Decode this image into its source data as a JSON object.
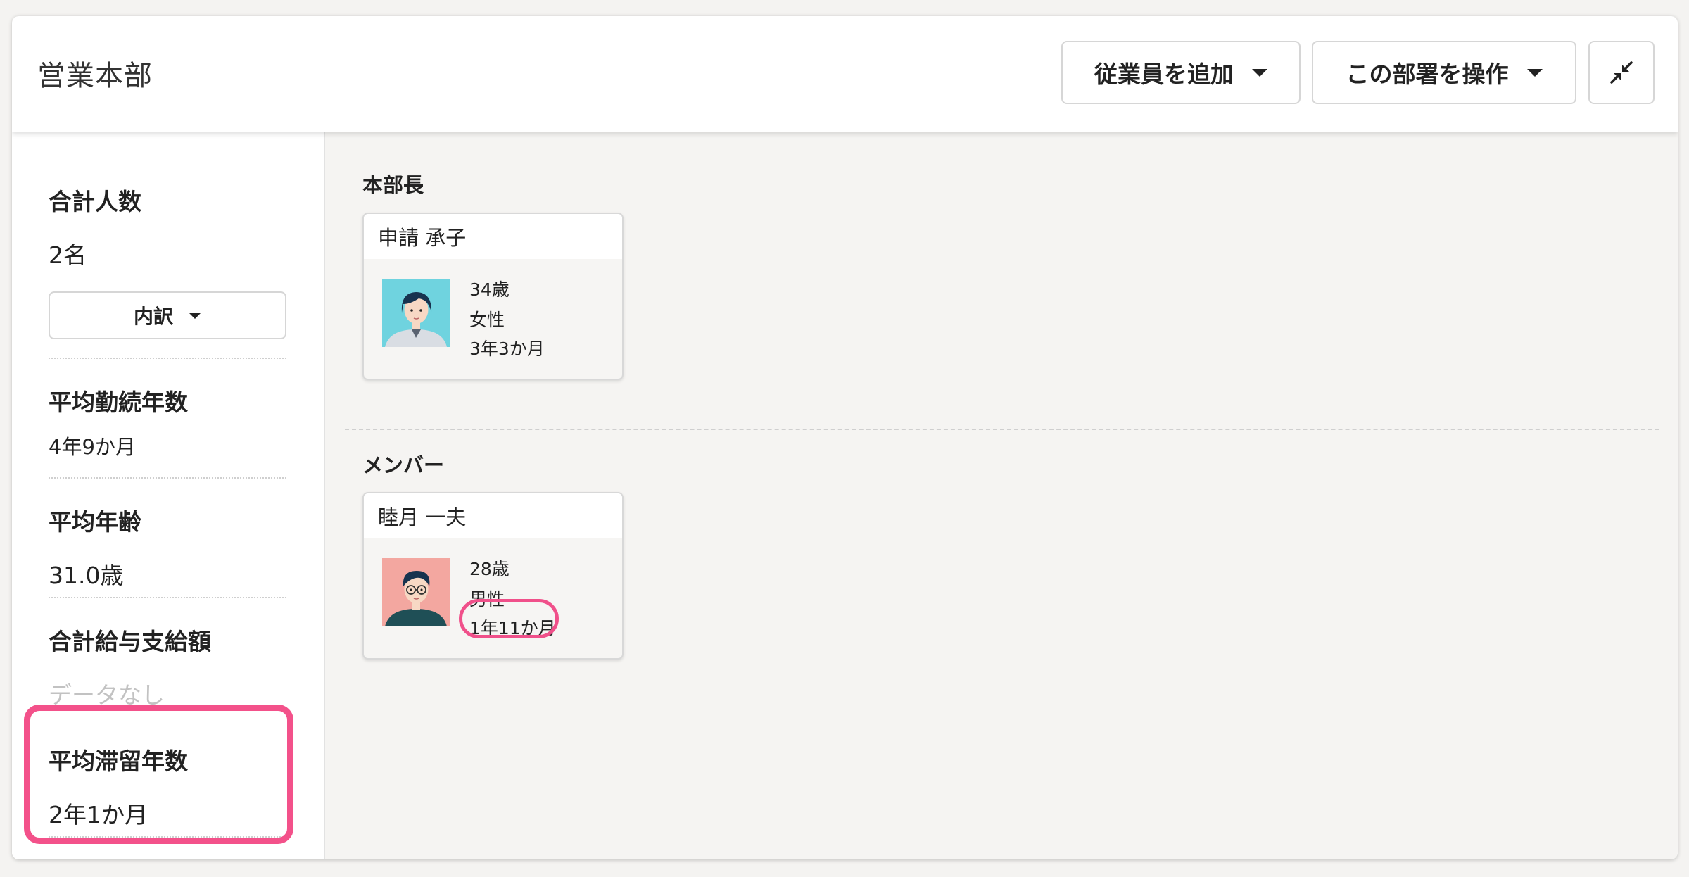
{
  "header": {
    "title": "営業本部",
    "add_employee_label": "従業員を追加",
    "operate_dept_label": "この部署を操作",
    "collapse_icon": "collapse-arrows-icon"
  },
  "sidebar": {
    "total_people_label": "合計人数",
    "total_people_value": "2名",
    "breakdown_label": "内訳",
    "avg_tenure_label": "平均勤続年数",
    "avg_tenure_value": "4年9か月",
    "avg_age_label": "平均年齢",
    "avg_age_value": "31.0歳",
    "total_salary_label": "合計給与支給額",
    "total_salary_value": "データなし",
    "avg_stay_label": "平均滞留年数",
    "avg_stay_value": "2年1か月"
  },
  "main": {
    "head_section_label": "本部長",
    "members_section_label": "メンバー",
    "head": {
      "name": "申請 承子",
      "age": "34歳",
      "gender": "女性",
      "tenure": "3年3か月",
      "avatar_color": "#6fd3df"
    },
    "member": {
      "name": "睦月 一夫",
      "age": "28歳",
      "gender": "男性",
      "tenure": "1年11か月",
      "avatar_color": "#f3a7a0"
    }
  },
  "colors": {
    "highlight": "#f3518a",
    "background": "#f4f3f1"
  }
}
